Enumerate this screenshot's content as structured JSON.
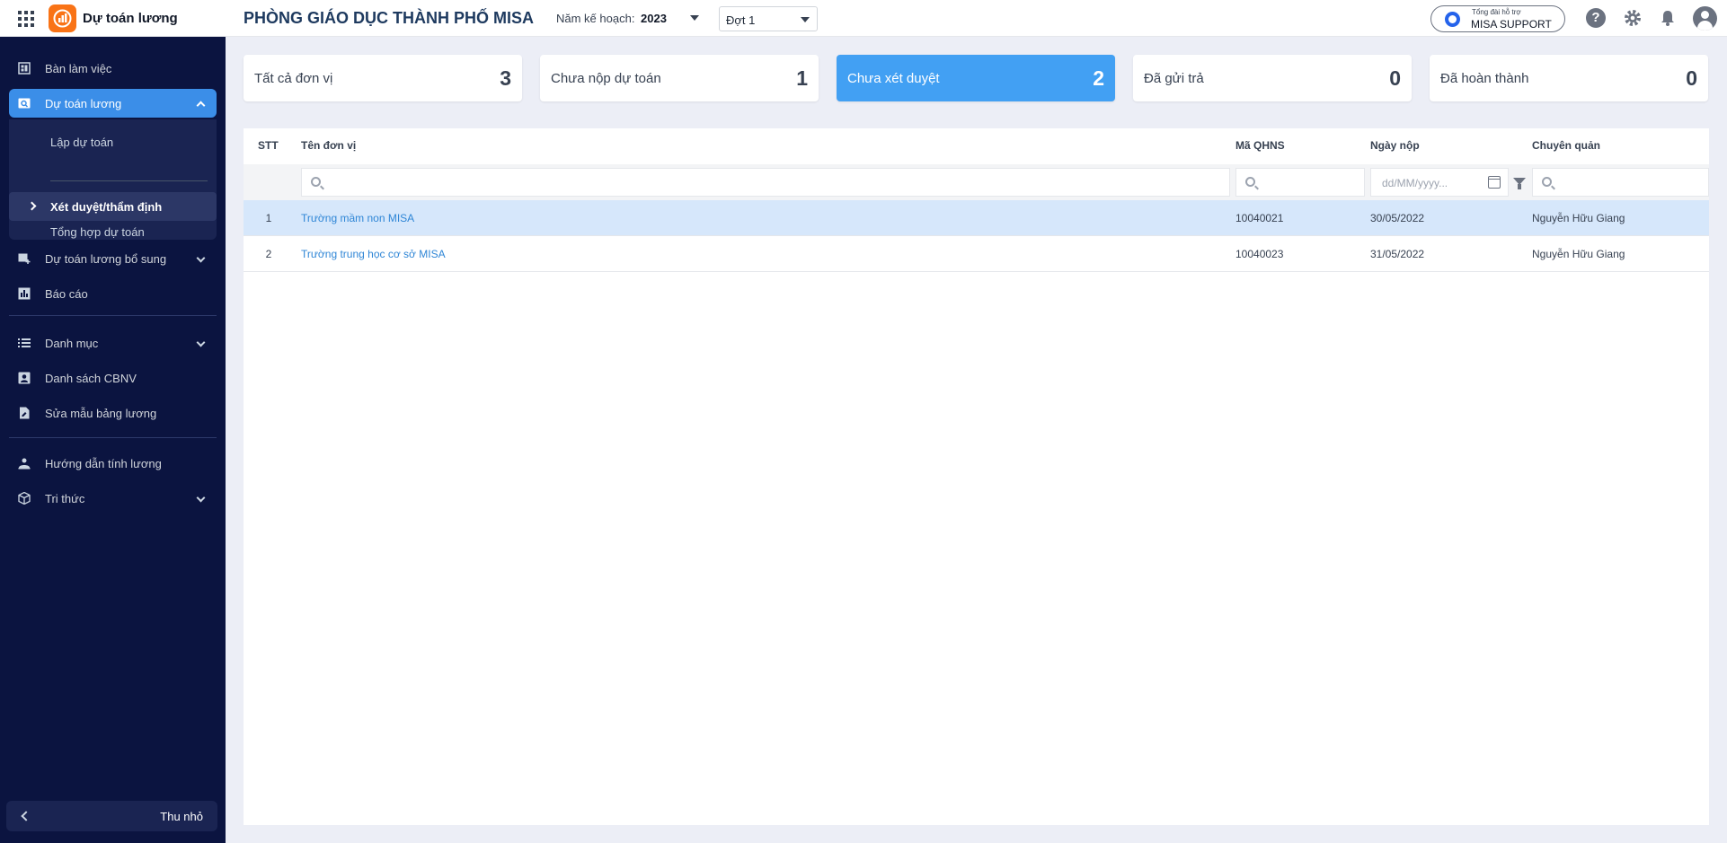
{
  "header": {
    "app_name": "Dự toán lương",
    "org_title": "PHÒNG GIÁO DỤC THÀNH PHỐ MISA",
    "plan_year_label": "Năm kế hoạch:",
    "plan_year_value": "2023",
    "period_value": "Đợt 1",
    "support_small": "Tổng đài hỗ trợ",
    "support_big": "MISA SUPPORT",
    "help_glyph": "?"
  },
  "sidebar": {
    "items": [
      {
        "label": "Bàn làm việc",
        "icon": "dashboard-icon"
      },
      {
        "label": "Dự toán lương",
        "icon": "budget-search-icon"
      },
      {
        "label": "Dự toán lương bổ sung",
        "icon": "budget-add-icon"
      },
      {
        "label": "Báo cáo",
        "icon": "report-icon"
      },
      {
        "label": "Danh mục",
        "icon": "list-icon"
      },
      {
        "label": "Danh sách CBNV",
        "icon": "staff-icon"
      },
      {
        "label": "Sửa mẫu bảng lương",
        "icon": "edit-template-icon"
      },
      {
        "label": "Hướng dẫn tính lương",
        "icon": "guide-icon"
      },
      {
        "label": "Tri thức",
        "icon": "knowledge-icon"
      }
    ],
    "sub_items": [
      {
        "label": "Lập dự toán"
      },
      {
        "label": "Xét duyệt/thẩm định"
      },
      {
        "label": "Tổng hợp dự toán"
      }
    ],
    "collapse_label": "Thu nhỏ"
  },
  "stats": [
    {
      "label": "Tất cả đơn vị",
      "count": "3"
    },
    {
      "label": "Chưa nộp dự toán",
      "count": "1"
    },
    {
      "label": "Chưa xét duyệt",
      "count": "2"
    },
    {
      "label": "Đã gửi trả",
      "count": "0"
    },
    {
      "label": "Đã hoàn thành",
      "count": "0"
    }
  ],
  "table": {
    "columns": {
      "stt": "STT",
      "name": "Tên đơn vị",
      "code": "Mã QHNS",
      "date": "Ngày nộp",
      "manager": "Chuyên quản"
    },
    "date_placeholder": "dd/MM/yyyy...",
    "rows": [
      {
        "stt": "1",
        "name": "Trường mầm non MISA",
        "code": "10040021",
        "date": "30/05/2022",
        "manager": "Nguyễn Hữu Giang"
      },
      {
        "stt": "2",
        "name": "Trường trung học cơ sở MISA",
        "code": "10040023",
        "date": "31/05/2022",
        "manager": "Nguyễn Hữu Giang"
      }
    ]
  }
}
